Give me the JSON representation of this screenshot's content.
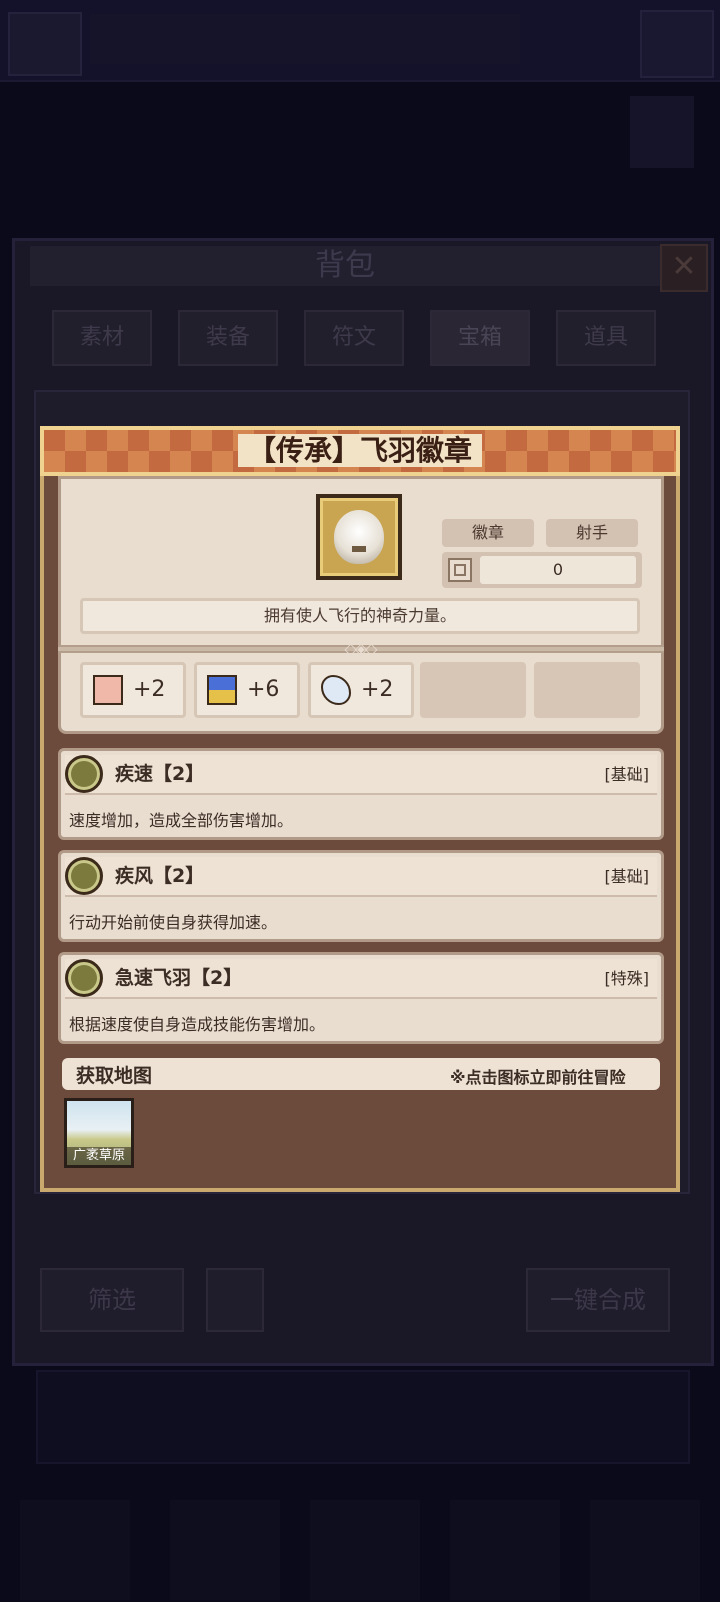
{
  "background": {
    "panel_title": "背包",
    "close_glyph": "✕",
    "tabs": [
      {
        "label": "素材"
      },
      {
        "label": "装备"
      },
      {
        "label": "符文"
      },
      {
        "label": "宝箱"
      },
      {
        "label": "道具"
      }
    ],
    "filter_label": "筛选",
    "merge_label": "一键合成"
  },
  "dialog": {
    "title": "【传承】飞羽徽章",
    "item_icon": "feather-badge-icon",
    "tags": [
      "徽章",
      "射手"
    ],
    "count": "0",
    "description": "拥有使人飞行的神奇力量。",
    "divider_ornament": "◇◈◇",
    "stats": [
      {
        "icon": "fist-icon",
        "value": "+2"
      },
      {
        "icon": "boot-icon",
        "value": "+6"
      },
      {
        "icon": "feather-icon",
        "value": "+2"
      }
    ],
    "skills": [
      {
        "icon": "speed-rune-icon",
        "name": "疾速【2】",
        "type": "[基础]",
        "desc": "速度增加，造成全部伤害增加。"
      },
      {
        "icon": "wind-rune-icon",
        "name": "疾风【2】",
        "type": "[基础]",
        "desc": "行动开始前使自身获得加速。"
      },
      {
        "icon": "feather-rune-icon",
        "name": "急速飞羽【2】",
        "type": "[特殊]",
        "desc": "根据速度使自身造成技能伤害增加。"
      }
    ],
    "map_section": {
      "title": "获取地图",
      "hint": "※点击图标立即前往冒险",
      "maps": [
        {
          "label": "广袤草原",
          "icon": "grassland-map-icon"
        }
      ]
    }
  },
  "colors": {
    "header": "#c46a40",
    "frame": "#6d4b3c",
    "card": "#e9ddd0",
    "text": "#3b2c24"
  }
}
